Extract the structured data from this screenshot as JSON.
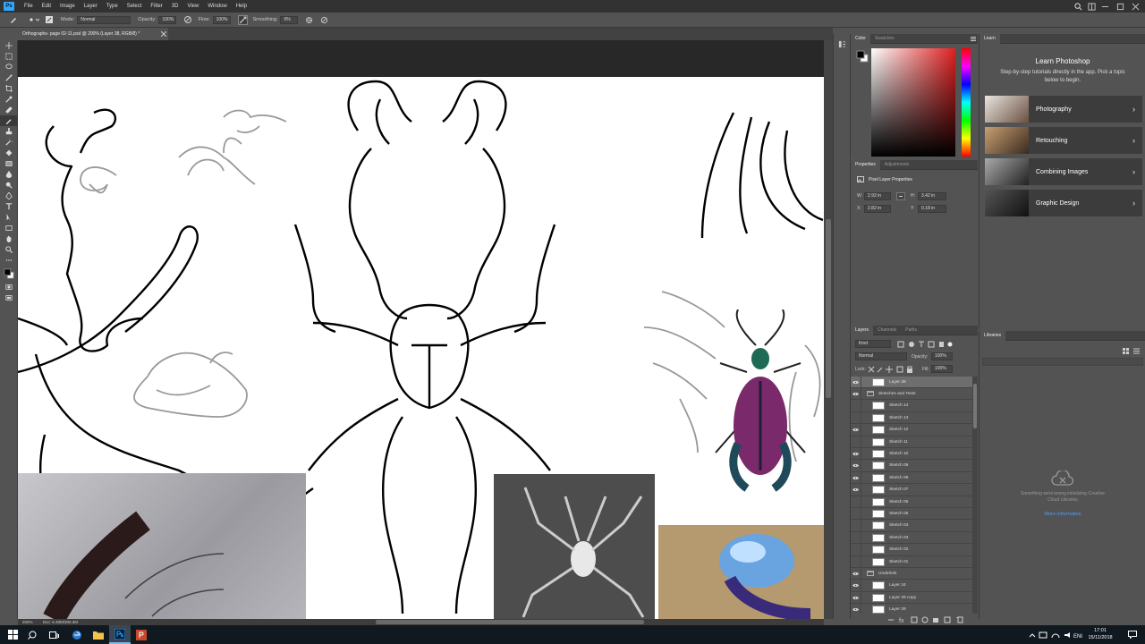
{
  "app": {
    "logo": "Ps"
  },
  "menu": [
    "File",
    "Edit",
    "Image",
    "Layer",
    "Type",
    "Select",
    "Filter",
    "3D",
    "View",
    "Window",
    "Help"
  ],
  "options_bar": {
    "mode_label": "Mode:",
    "mode_value": "Normal",
    "opacity_label": "Opacity:",
    "opacity_value": "100%",
    "flow_label": "Flow:",
    "flow_value": "100%",
    "smoothing_label": "Smoothing:",
    "smoothing_value": "0%"
  },
  "document": {
    "tab_title": "Orthographs- page 02-11.psd @ 200% (Layer 38, RGB/8) *"
  },
  "status_bar": {
    "zoom": "200%",
    "doc_info": "Doc: 6.49M/300.3M"
  },
  "color_panel": {
    "tabs": [
      "Color",
      "Swatches"
    ],
    "hue_color": "#e02020"
  },
  "properties_panel": {
    "tabs": [
      "Properties",
      "Adjustments"
    ],
    "heading": "Pixel Layer Properties",
    "w_label": "W:",
    "w_value": "2.92 in",
    "h_label": "H:",
    "h_value": "3.42 in",
    "x_label": "X:",
    "x_value": "2.82 in",
    "y_label": "Y:",
    "y_value": "0.18 in"
  },
  "layers_panel": {
    "tabs": [
      "Layers",
      "Channels",
      "Paths"
    ],
    "kind_label": "Kind",
    "blend_mode": "Normal",
    "opacity_label": "Opacity:",
    "opacity_value": "100%",
    "lock_label": "Lock:",
    "fill_label": "Fill:",
    "fill_value": "100%",
    "layers": [
      {
        "name": "Layer 38",
        "visible": true,
        "selected": true,
        "type": "layer"
      },
      {
        "name": "Sketches and Tests",
        "visible": true,
        "type": "group"
      },
      {
        "name": "Sketch 14",
        "visible": false,
        "type": "layer"
      },
      {
        "name": "Sketch 13",
        "visible": false,
        "type": "layer"
      },
      {
        "name": "Sketch 12",
        "visible": true,
        "type": "layer"
      },
      {
        "name": "Sketch 11",
        "visible": false,
        "type": "layer"
      },
      {
        "name": "Sketch 10",
        "visible": true,
        "type": "layer"
      },
      {
        "name": "Sketch 09",
        "visible": true,
        "type": "layer"
      },
      {
        "name": "Sketch 08",
        "visible": true,
        "type": "layer"
      },
      {
        "name": "Sketch 07",
        "visible": true,
        "type": "layer"
      },
      {
        "name": "Sketch 06",
        "visible": false,
        "type": "layer"
      },
      {
        "name": "Sketch 05",
        "visible": false,
        "type": "layer"
      },
      {
        "name": "Sketch 04",
        "visible": false,
        "type": "layer"
      },
      {
        "name": "Sketch 03",
        "visible": false,
        "type": "layer"
      },
      {
        "name": "Sketch 02",
        "visible": false,
        "type": "layer"
      },
      {
        "name": "Sketch 01",
        "visible": false,
        "type": "layer"
      },
      {
        "name": "Underlols",
        "visible": true,
        "type": "group"
      },
      {
        "name": "Layer 24",
        "visible": true,
        "type": "layer"
      },
      {
        "name": "Layer 29 copy",
        "visible": true,
        "type": "layer"
      },
      {
        "name": "Layer 29",
        "visible": true,
        "type": "layer"
      }
    ]
  },
  "learn_panel": {
    "tab": "Learn",
    "title": "Learn Photoshop",
    "subtitle": "Step-by-step tutorials directly in the app. Pick a topic below to begin.",
    "topics": [
      "Photography",
      "Retouching",
      "Combining Images",
      "Graphic Design"
    ]
  },
  "libraries_panel": {
    "tab": "Libraries",
    "error": "Something went wrong initializing Creative Cloud Libraries",
    "link": "More information"
  },
  "taskbar": {
    "time": "17:01",
    "date": "15/11/2018"
  }
}
